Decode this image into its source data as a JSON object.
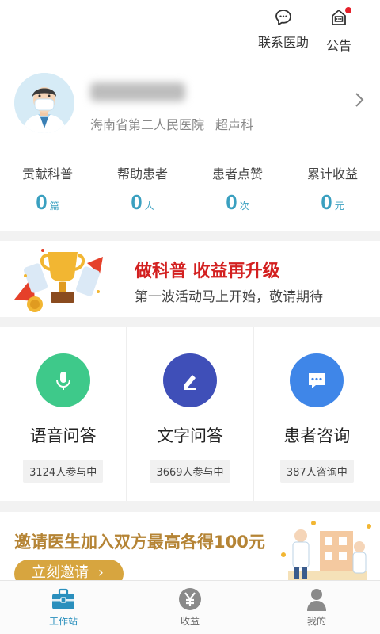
{
  "header": {
    "contact_label": "联系医助",
    "notice_label": "公告"
  },
  "profile": {
    "hospital": "海南省第二人民医院",
    "department": "超声科"
  },
  "stats": [
    {
      "title": "贡献科普",
      "value": "0",
      "unit": "篇"
    },
    {
      "title": "帮助患者",
      "value": "0",
      "unit": "人"
    },
    {
      "title": "患者点赞",
      "value": "0",
      "unit": "次"
    },
    {
      "title": "累计收益",
      "value": "0",
      "unit": "元"
    }
  ],
  "banner": {
    "title": "做科普 收益再升级",
    "subtitle": "第一波活动马上开始，敬请期待"
  },
  "services": [
    {
      "name": "语音问答",
      "badge": "3124人参与中",
      "icon": "microphone-icon",
      "color": "#3ec98a"
    },
    {
      "name": "文字问答",
      "badge": "3669人参与中",
      "icon": "pencil-icon",
      "color": "#3f4fb8"
    },
    {
      "name": "患者咨询",
      "badge": "387人咨询中",
      "icon": "chat-icon",
      "color": "#3f86e8"
    }
  ],
  "invite": {
    "title": "邀请医生加入双方最高各得100元",
    "button": "立刻邀请"
  },
  "tabs": [
    {
      "label": "工作站",
      "icon": "briefcase-icon",
      "active": true
    },
    {
      "label": "收益",
      "icon": "yen-icon",
      "active": false
    },
    {
      "label": "我的",
      "icon": "person-icon",
      "active": false
    }
  ]
}
